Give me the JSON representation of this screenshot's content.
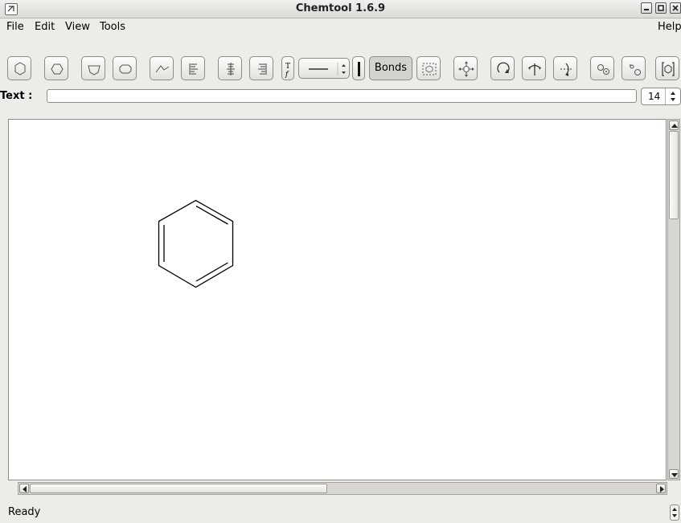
{
  "window": {
    "title": "Chemtool 1.6.9"
  },
  "menu": {
    "file": "File",
    "edit": "Edit",
    "view": "View",
    "tools": "Tools",
    "help": "Help"
  },
  "toolbar": {
    "bonds_label": "Bonds"
  },
  "text_row": {
    "label": "Text :",
    "value": "",
    "font_size": "14"
  },
  "status": {
    "text": "Ready"
  },
  "canvas": {
    "molecule": "benzene"
  },
  "icons": {
    "window_menu": "app-menu-icon",
    "minimize": "minimize-icon",
    "maximize": "maximize-icon",
    "close": "close-icon"
  },
  "colors": {
    "canvas_bg": "#ffffff",
    "chrome_bg": "#edece9",
    "bond": "#000000"
  }
}
